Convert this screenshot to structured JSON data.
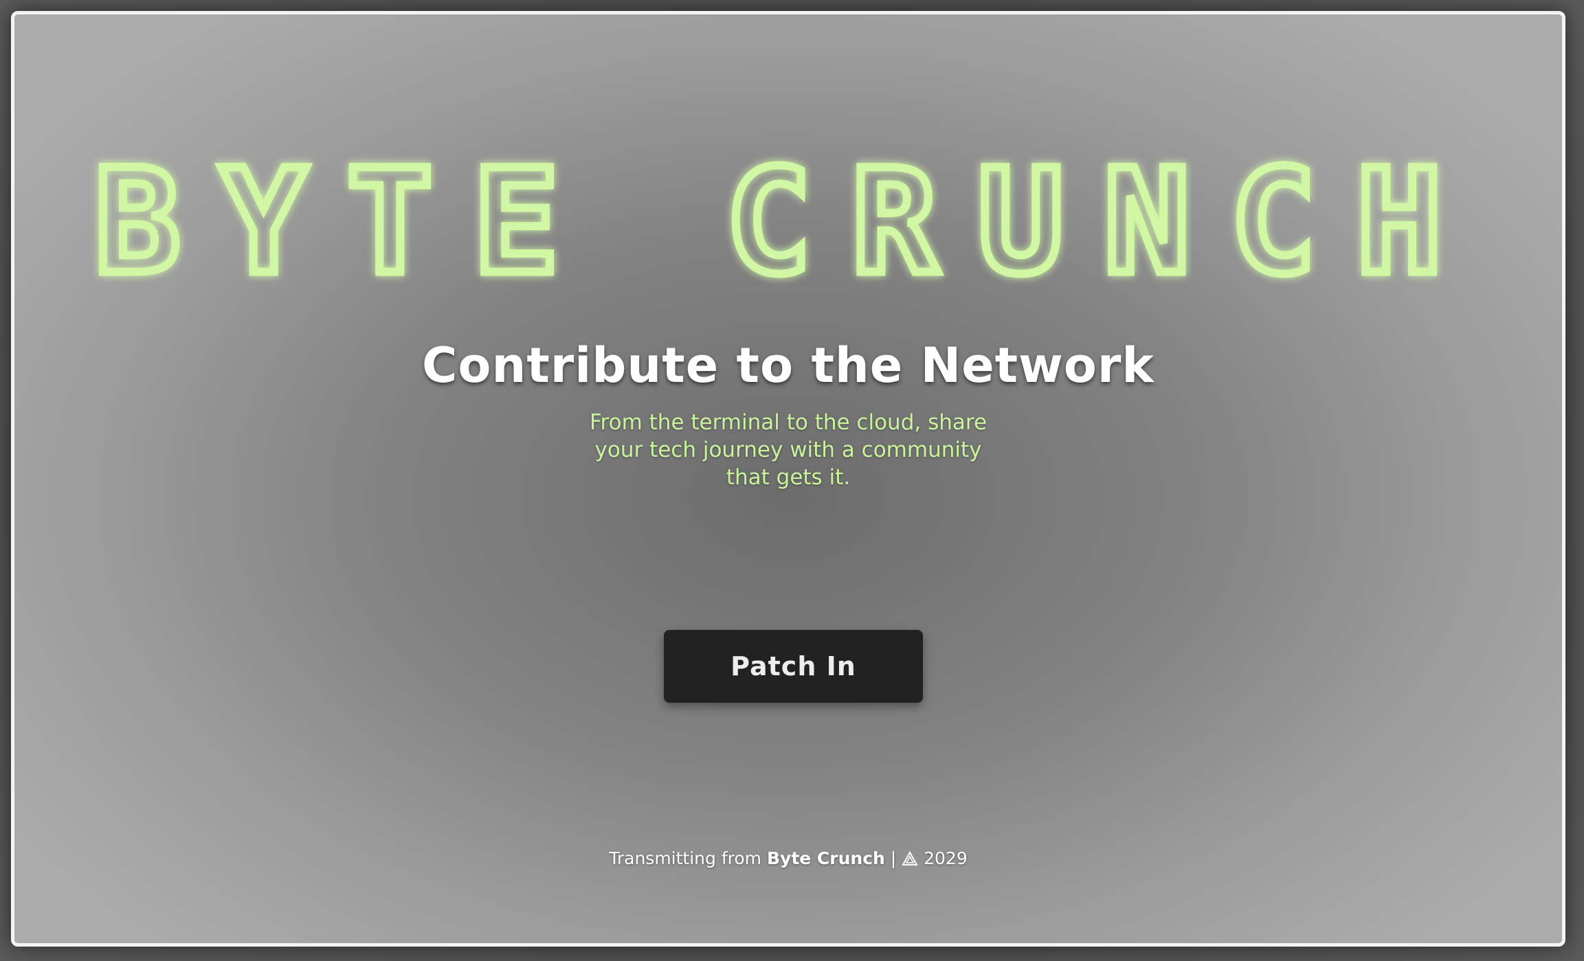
{
  "brand": {
    "logo_text": "BYTE CRUNCH",
    "logo_color": "#d2f7a4"
  },
  "hero": {
    "headline": "Contribute to the Network",
    "subtext": "From the terminal to the cloud, share your tech journey with a community that gets it.",
    "subtext_color": "#c9f49c",
    "cta_label": "Patch In"
  },
  "footer": {
    "prefix": "Transmitting from ",
    "brand_name": "Byte Crunch",
    "separator": " | ",
    "icon": "triangle-logo-icon",
    "year": "2029"
  }
}
